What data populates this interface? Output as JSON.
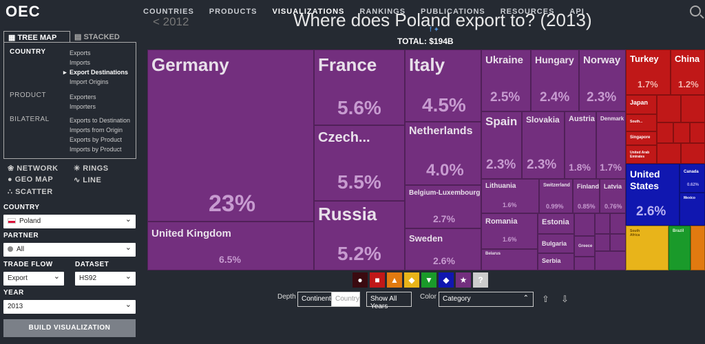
{
  "logo": "OEC",
  "nav": [
    "COUNTRIES",
    "PRODUCTS",
    "VISUALIZATIONS",
    "RANKINGS",
    "PUBLICATIONS",
    "RESOURCES",
    "API"
  ],
  "sidebar": {
    "tabs": [
      "TREE MAP",
      "STACKED"
    ],
    "sections": [
      {
        "label": "COUNTRY",
        "items": [
          "Exports",
          "Imports",
          "Export Destinations",
          "Import Origins"
        ]
      },
      {
        "label": "PRODUCT",
        "items": [
          "Exporters",
          "Importers"
        ]
      },
      {
        "label": "BILATERAL",
        "items": [
          "Exports to Destination",
          "Imports from Origin",
          "Exports by Product",
          "Imports by Product"
        ]
      }
    ],
    "viz_types": [
      "NETWORK",
      "RINGS",
      "GEO MAP",
      "LINE",
      "SCATTER"
    ],
    "country_label": "COUNTRY",
    "country_value": "Poland",
    "partner_label": "PARTNER",
    "partner_value": "All",
    "trade_flow_label": "TRADE FLOW",
    "trade_flow_value": "Export",
    "dataset_label": "DATASET",
    "dataset_value": "HS92",
    "year_label": "YEAR",
    "year_value": "2013",
    "build_label": "BUILD VISUALIZATION"
  },
  "main": {
    "back_year": "< 2012",
    "title": "Where does Poland export to? (2013)",
    "total": "TOTAL: $194B"
  },
  "treemap": {
    "cells": [
      {
        "name": "Germany",
        "pct": "23%"
      },
      {
        "name": "United Kingdom",
        "pct": "6.5%"
      },
      {
        "name": "France",
        "pct": "5.6%"
      },
      {
        "name": "Czech...",
        "pct": "5.5%"
      },
      {
        "name": "Russia",
        "pct": "5.2%"
      },
      {
        "name": "Italy",
        "pct": "4.5%"
      },
      {
        "name": "Netherlands",
        "pct": "4.0%"
      },
      {
        "name": "Belgium-Luxembourg",
        "pct": "2.7%"
      },
      {
        "name": "Sweden",
        "pct": "2.6%"
      },
      {
        "name": "Ukraine",
        "pct": "2.5%"
      },
      {
        "name": "Hungary",
        "pct": "2.4%"
      },
      {
        "name": "Norway",
        "pct": "2.3%"
      },
      {
        "name": "Spain",
        "pct": "2.3%"
      },
      {
        "name": "Slovakia",
        "pct": "2.3%"
      },
      {
        "name": "Austria",
        "pct": "1.8%"
      },
      {
        "name": "Denmark",
        "pct": "1.7%"
      },
      {
        "name": "Lithuania",
        "pct": "1.6%"
      },
      {
        "name": "Switzerland",
        "pct": "0.99%"
      },
      {
        "name": "Finland",
        "pct": "0.85%"
      },
      {
        "name": "Latvia",
        "pct": "0.76%"
      },
      {
        "name": "Romania",
        "pct": "1.6%"
      },
      {
        "name": "Estonia",
        "pct": ""
      },
      {
        "name": "Bulgaria",
        "pct": ""
      },
      {
        "name": "Serbia",
        "pct": ""
      },
      {
        "name": "Greece",
        "pct": ""
      },
      {
        "name": "Belarus",
        "pct": ""
      },
      {
        "name": "Turkey",
        "pct": "1.7%"
      },
      {
        "name": "China",
        "pct": "1.2%"
      },
      {
        "name": "Japan",
        "pct": ""
      },
      {
        "name": "South...",
        "pct": ""
      },
      {
        "name": "Singapore",
        "pct": ""
      },
      {
        "name": "United Arab Emirates",
        "pct": ""
      },
      {
        "name": "United States",
        "pct": "2.6%"
      },
      {
        "name": "Canada",
        "pct": "0.62%"
      },
      {
        "name": "Mexico",
        "pct": ""
      },
      {
        "name": "South Africa",
        "pct": ""
      },
      {
        "name": "Brazil",
        "pct": ""
      }
    ]
  },
  "controls": {
    "depth_label": "Depth",
    "depth_opts": [
      "Continent",
      "Country"
    ],
    "show_years": "Show All Years",
    "color_label": "Color",
    "color_value": "Category"
  }
}
